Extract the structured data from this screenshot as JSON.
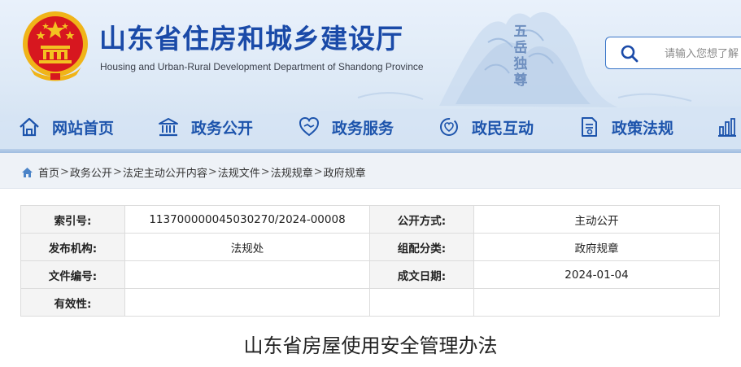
{
  "header": {
    "title": "山东省住房和城乡建设厅",
    "subtitle": "Housing and Urban-Rural Development Department of Shandong Province",
    "seal_text": "五岳独尊",
    "search_placeholder": "请输入您想了解"
  },
  "nav": {
    "items": [
      {
        "label": "网站首页",
        "icon": "home-icon"
      },
      {
        "label": "政务公开",
        "icon": "government-building-icon"
      },
      {
        "label": "政务服务",
        "icon": "handshake-heart-icon"
      },
      {
        "label": "政民互动",
        "icon": "interaction-icon"
      },
      {
        "label": "政策法规",
        "icon": "document-icon"
      },
      {
        "label": "",
        "icon": "statistics-chart-icon"
      }
    ]
  },
  "breadcrumb": {
    "items": [
      "首页",
      "政务公开",
      "法定主动公开内容",
      "法规文件",
      "法规规章",
      "政府规章"
    ],
    "separator": ">"
  },
  "info": {
    "rows": [
      {
        "l1": "索引号:",
        "v1": "113700000045030270/2024-00008",
        "l2": "公开方式:",
        "v2": "主动公开"
      },
      {
        "l1": "发布机构:",
        "v1": "法规处",
        "l2": "组配分类:",
        "v2": "政府规章"
      },
      {
        "l1": "文件编号:",
        "v1": "",
        "l2": "成文日期:",
        "v2": "2024-01-04"
      },
      {
        "l1": "有效性:",
        "v1": "",
        "l2": "",
        "v2": ""
      }
    ]
  },
  "doc": {
    "title": "山东省房屋使用安全管理办法"
  },
  "colors": {
    "brand_blue": "#1a4aa8",
    "nav_blue": "#1d54ac",
    "emblem_red": "#d7171f",
    "emblem_gold": "#f3c221"
  }
}
